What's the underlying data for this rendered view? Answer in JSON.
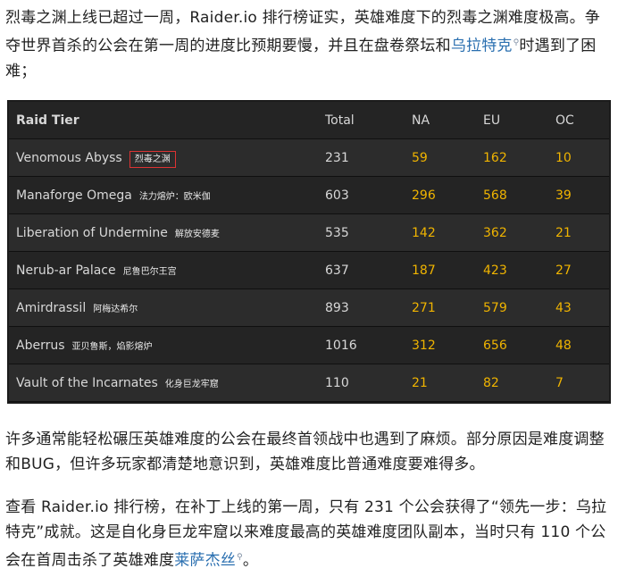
{
  "intro": {
    "text1": "烈毒之渊上线已超过一周，Raider.io 排行榜证实，英雄难度下的烈毒之渊难度极高。争夺世界首杀的公会在第一周的进度比预期要慢，并且在盘卷祭坛和",
    "link": "乌拉特克",
    "text2": "时遇到了困难；"
  },
  "table": {
    "headers": {
      "name": "Raid Tier",
      "total": "Total",
      "na": "NA",
      "eu": "EU",
      "oc": "OC"
    },
    "rows": [
      {
        "name": "Venomous Abyss",
        "cn": "烈毒之渊",
        "total": "231",
        "na": "59",
        "eu": "162",
        "oc": "10"
      },
      {
        "name": "Manaforge Omega",
        "cn": "法力熔炉：欧米伽",
        "total": "603",
        "na": "296",
        "eu": "568",
        "oc": "39"
      },
      {
        "name": "Liberation of Undermine",
        "cn": "解放安德麦",
        "total": "535",
        "na": "142",
        "eu": "362",
        "oc": "21"
      },
      {
        "name": "Nerub-ar Palace",
        "cn": "尼鲁巴尔王宫",
        "total": "637",
        "na": "187",
        "eu": "423",
        "oc": "27"
      },
      {
        "name": "Amirdrassil",
        "cn": "阿梅达希尔",
        "total": "893",
        "na": "271",
        "eu": "579",
        "oc": "43"
      },
      {
        "name": "Aberrus",
        "cn": "亚贝鲁斯，焰影熔炉",
        "total": "1016",
        "na": "312",
        "eu": "656",
        "oc": "48"
      },
      {
        "name": "Vault of the Incarnates",
        "cn": "化身巨龙牢窟",
        "total": "110",
        "na": "21",
        "eu": "82",
        "oc": "7"
      }
    ]
  },
  "para2": "许多通常能轻松碾压英雄难度的公会在最终首领战中也遇到了麻烦。部分原因是难度调整和BUG，但许多玩家都清楚地意识到，英雄难度比普通难度要难得多。",
  "para3": {
    "text1": "查看 Raider.io 排行榜，在补丁上线的第一周，只有 231 个公会获得了“领先一步：乌拉特克”成就。这是自化身巨龙牢窟以来难度最高的英雄难度团队副本，当时只有 110 个公会在首周击杀了英雄难度",
    "link": "莱萨杰丝",
    "text2": "。"
  },
  "colors": {
    "link": "#2a6fb0",
    "value": "#f0b400",
    "table_bg": "#1b1b1b",
    "highlight_box": "#dd3333"
  },
  "icons": {
    "link_marker": "search-icon"
  }
}
